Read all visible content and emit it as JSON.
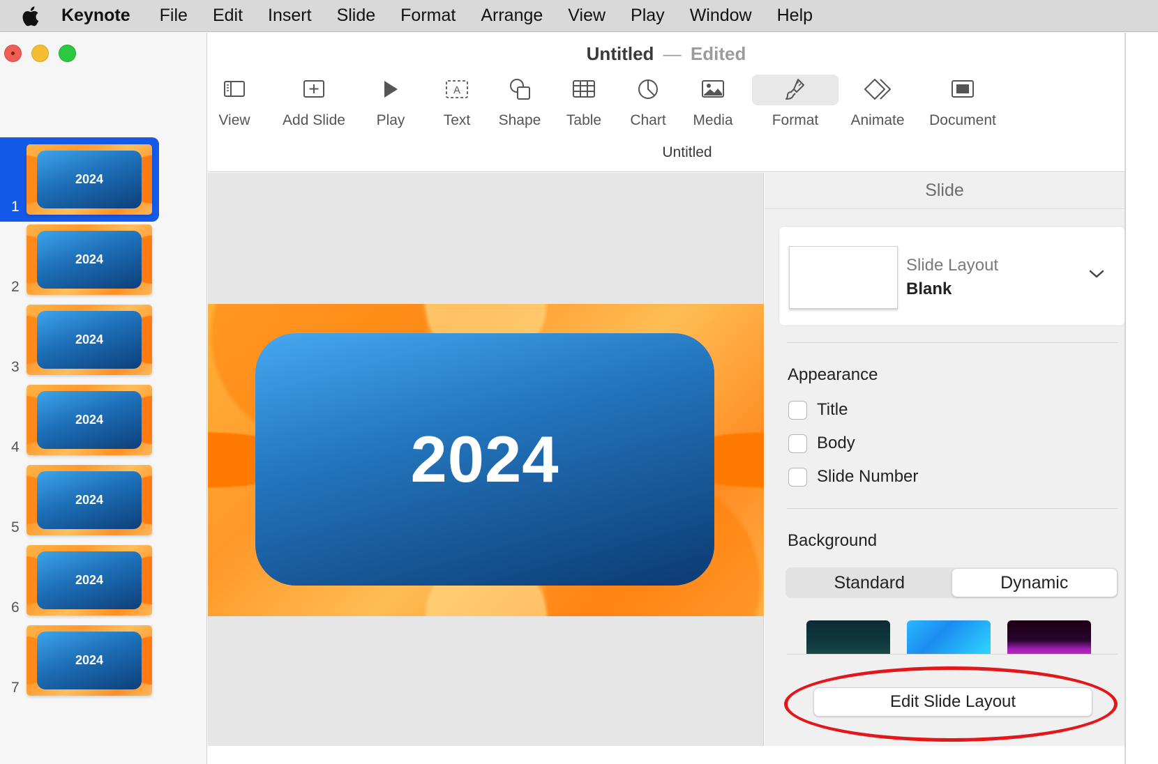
{
  "menubar": {
    "app": "Keynote",
    "items": [
      "File",
      "Edit",
      "Insert",
      "Slide",
      "Format",
      "Arrange",
      "View",
      "Play",
      "Window",
      "Help"
    ]
  },
  "window": {
    "title": "Untitled",
    "separator": "—",
    "status": "Edited",
    "subtitle": "Untitled"
  },
  "toolbar": {
    "view": "View",
    "add_slide": "Add Slide",
    "play": "Play",
    "text": "Text",
    "shape": "Shape",
    "table": "Table",
    "chart": "Chart",
    "media": "Media",
    "format": "Format",
    "animate": "Animate",
    "document": "Document"
  },
  "slides": [
    {
      "number": "1",
      "text": "2024",
      "selected": true
    },
    {
      "number": "2",
      "text": "2024"
    },
    {
      "number": "3",
      "text": "2024"
    },
    {
      "number": "4",
      "text": "2024"
    },
    {
      "number": "5",
      "text": "2024"
    },
    {
      "number": "6",
      "text": "2024"
    },
    {
      "number": "7",
      "text": "2024"
    }
  ],
  "canvas": {
    "slide_text": "2024"
  },
  "inspector": {
    "tab": "Slide",
    "layout_label": "Slide Layout",
    "layout_value": "Blank",
    "appearance_title": "Appearance",
    "appearance": {
      "title": "Title",
      "body": "Body",
      "slide_number": "Slide Number"
    },
    "background_title": "Background",
    "background_tabs": {
      "standard": "Standard",
      "dynamic": "Dynamic",
      "selected": "Dynamic"
    },
    "edit_layout_button": "Edit Slide Layout"
  },
  "colors": {
    "selection": "#1559e8",
    "highlight_annotation": "#e3161a"
  }
}
